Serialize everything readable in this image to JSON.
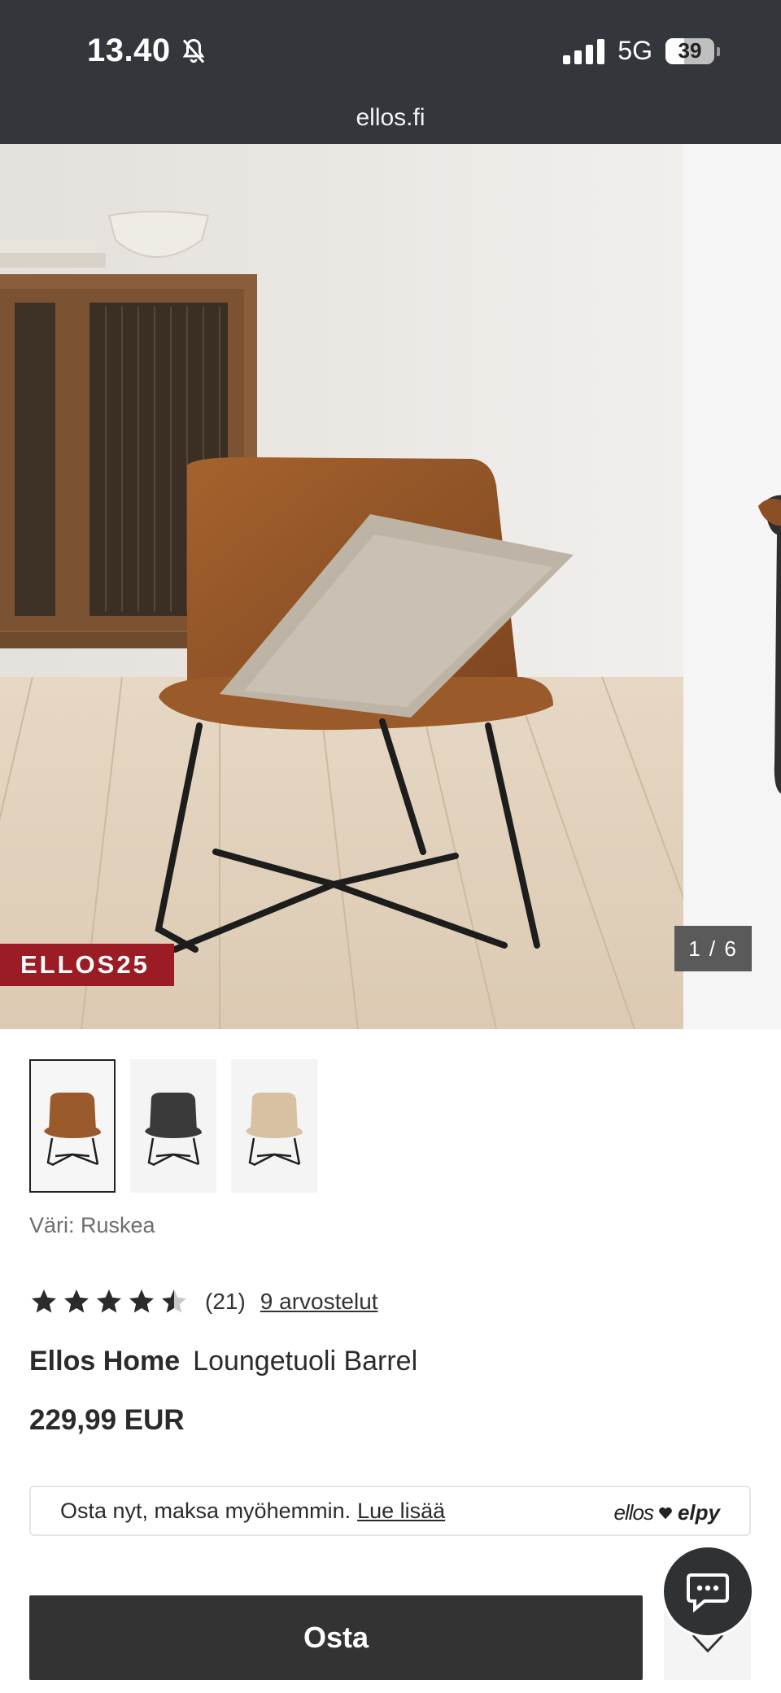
{
  "status_bar": {
    "time": "13.40",
    "network": "5G",
    "battery": "39",
    "battery_level": 0.39
  },
  "browser": {
    "url": "ellos.fi"
  },
  "gallery": {
    "promo_badge": "ELLOS25",
    "counter": "1 / 6"
  },
  "thumbnails": [
    {
      "color_name": "brown",
      "color": "#9a5a2b",
      "selected": true
    },
    {
      "color_name": "black",
      "color": "#3a3a3a",
      "selected": false
    },
    {
      "color_name": "beige",
      "color": "#d8c0a3",
      "selected": false
    }
  ],
  "color_label": "Väri: Ruskea",
  "rating": {
    "value": 4.5,
    "max": 5,
    "count": "(21)",
    "reviews_link": "9 arvostelut"
  },
  "product": {
    "brand": "Ellos Home",
    "name": "Loungetuoli Barrel",
    "price": "229,99 EUR"
  },
  "payment": {
    "text": "Osta nyt, maksa myöhemmin.",
    "link": "Lue lisää",
    "logo_left": "ellos",
    "logo_right": "elpy"
  },
  "actions": {
    "buy_label": "Osta"
  },
  "colors": {
    "topbar": "#33363a",
    "promo": "#9b1c24",
    "buy_button": "#333333"
  }
}
